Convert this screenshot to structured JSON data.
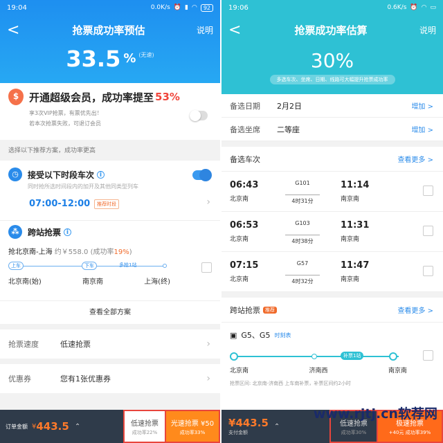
{
  "left": {
    "status": {
      "time": "19:04",
      "speed": "0.0K/s",
      "battery": "92"
    },
    "nav": {
      "back": "<",
      "title": "抢票成功率预估",
      "help": "说明"
    },
    "rate": {
      "value": "33.5",
      "unit": "%",
      "note": "(无速)"
    },
    "vip": {
      "title": "开通超级会员，成功率提至",
      "pct": "53%",
      "line1": "享3次VIP抢票，有票优先出！",
      "line2": "若本次抢票失败，可退订会员"
    },
    "hint": "选择以下推荐方案，成功率更高",
    "accept": {
      "title": "接受以下时段车次",
      "sub": "同时抢所选时间段内的加开及其他同类型列车",
      "time": "07:00-12:00",
      "tag": "推荐时段"
    },
    "cross": {
      "title": "跨站抢票",
      "route": "抢北京南-上海",
      "price": "约￥558.0",
      "pct_label": "(成功率",
      "pct": "19%",
      "pct_close": ")",
      "tag_board": "上车",
      "tag_alight": "下车",
      "mid": "多抢1站",
      "st1": "北京南(始)",
      "st2": "南京南",
      "st3": "上海(终)"
    },
    "view_all": "查看全部方案",
    "speed": {
      "k": "抢票速度",
      "v": "低速抢票"
    },
    "coupon": {
      "k": "优惠券",
      "v": "您有1张优惠券"
    },
    "bottom": {
      "label": "订单金额",
      "yen": "¥",
      "amount": "443.5",
      "slow": "低速抢票",
      "slow_sub": "成功率22%",
      "fast": "光速抢票 ¥50",
      "fast_sub": "成功率33%"
    }
  },
  "right": {
    "status": {
      "time": "19:06",
      "speed": "0.6K/s"
    },
    "nav": {
      "back": "<",
      "title": "抢票成功率估算",
      "help": "说明"
    },
    "rate": {
      "value": "30%",
      "pill": "多选车次、坐席、日期、线路可大幅提升抢票成功率"
    },
    "date": {
      "k": "备选日期",
      "v": "2月2日",
      "add": "增加 >"
    },
    "seat": {
      "k": "备选坐席",
      "v": "二等座",
      "add": "增加 >"
    },
    "trains_title": "备选车次",
    "more": "查看更多 >",
    "trains": [
      {
        "dep": "06:43",
        "ds": "北京南",
        "no": "G101",
        "dur": "4时31分",
        "arr": "11:14",
        "as": "南京南"
      },
      {
        "dep": "06:53",
        "ds": "北京南",
        "no": "G103",
        "dur": "4时38分",
        "arr": "11:31",
        "as": "南京南"
      },
      {
        "dep": "07:15",
        "ds": "北京南",
        "no": "G57",
        "dur": "4时32分",
        "arr": "11:47",
        "as": "南京南"
      }
    ],
    "cross": {
      "title": "跨站抢票",
      "hot": "推荐",
      "more": "查看更多 >",
      "train": "G5、G5",
      "timetable": "时刻表",
      "buy": "补票1站",
      "st1": "北京南",
      "st2": "济南西",
      "st3": "南京南",
      "note": "抢票区间: 北京南-济南西  上车南补票，补票区间约2小时"
    },
    "bottom": {
      "yen": "¥",
      "amount": "443.5",
      "label": "支付金额",
      "slow": "低速抢票",
      "slow_sub": "成功率30%",
      "fast": "极速抢票",
      "fast_sub": "+40元 成功率39%"
    }
  },
  "watermark": "www.rjtj.cn软荐网"
}
